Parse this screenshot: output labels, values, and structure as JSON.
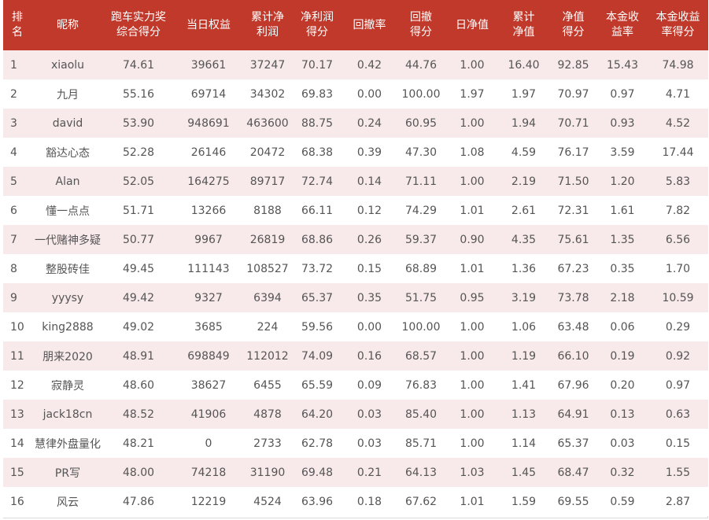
{
  "table": {
    "headers": [
      [
        "排",
        "名"
      ],
      [
        "昵称"
      ],
      [
        "跑车实力奖",
        "综合得分"
      ],
      [
        "当日权益"
      ],
      [
        "累计净",
        "利润"
      ],
      [
        "净利润",
        "得分"
      ],
      [
        "回撤率"
      ],
      [
        "回撤",
        "得分"
      ],
      [
        "日净值"
      ],
      [
        "累计",
        "净值"
      ],
      [
        "净值",
        "得分"
      ],
      [
        "本金收",
        "益率"
      ],
      [
        "本金收益",
        "率得分"
      ]
    ],
    "rows": [
      [
        "1",
        "xiaolu",
        "74.61",
        "39661",
        "37247",
        "70.17",
        "0.42",
        "44.76",
        "1.00",
        "16.40",
        "92.85",
        "15.43",
        "74.98"
      ],
      [
        "2",
        "九月",
        "55.16",
        "69714",
        "34302",
        "69.83",
        "0.00",
        "100.00",
        "1.97",
        "1.97",
        "70.97",
        "0.97",
        "4.71"
      ],
      [
        "3",
        "david",
        "53.90",
        "948691",
        "463600",
        "88.75",
        "0.24",
        "60.95",
        "1.00",
        "1.94",
        "70.71",
        "0.93",
        "4.52"
      ],
      [
        "4",
        "豁达心态",
        "52.28",
        "26146",
        "20472",
        "68.38",
        "0.39",
        "47.30",
        "1.08",
        "4.59",
        "76.17",
        "3.59",
        "17.44"
      ],
      [
        "5",
        "Alan",
        "52.05",
        "164275",
        "89717",
        "72.74",
        "0.14",
        "71.11",
        "1.00",
        "2.19",
        "71.50",
        "1.20",
        "5.83"
      ],
      [
        "6",
        "懂一点点",
        "51.71",
        "13266",
        "8188",
        "66.11",
        "0.12",
        "74.29",
        "1.01",
        "2.61",
        "72.31",
        "1.61",
        "7.82"
      ],
      [
        "7",
        "一代赌神多疑",
        "50.77",
        "9967",
        "26819",
        "68.86",
        "0.26",
        "59.37",
        "0.90",
        "4.35",
        "75.61",
        "1.35",
        "6.56"
      ],
      [
        "8",
        "整股砖佳",
        "49.45",
        "111143",
        "108527",
        "73.72",
        "0.15",
        "68.89",
        "1.01",
        "1.36",
        "67.23",
        "0.35",
        "1.70"
      ],
      [
        "9",
        "yyysy",
        "49.42",
        "9327",
        "6394",
        "65.37",
        "0.35",
        "51.75",
        "0.95",
        "3.19",
        "73.78",
        "2.18",
        "10.59"
      ],
      [
        "10",
        "king2888",
        "49.02",
        "3685",
        "224",
        "59.56",
        "0.00",
        "100.00",
        "1.00",
        "1.06",
        "63.48",
        "0.06",
        "0.29"
      ],
      [
        "11",
        "朋来2020",
        "48.91",
        "698849",
        "112012",
        "74.09",
        "0.16",
        "68.57",
        "1.00",
        "1.19",
        "66.10",
        "0.19",
        "0.92"
      ],
      [
        "12",
        "寂静灵",
        "48.60",
        "38627",
        "6455",
        "65.59",
        "0.09",
        "76.83",
        "1.00",
        "1.41",
        "67.96",
        "0.20",
        "0.97"
      ],
      [
        "13",
        "jack18cn",
        "48.52",
        "41906",
        "4878",
        "64.20",
        "0.03",
        "85.40",
        "1.00",
        "1.13",
        "64.91",
        "0.13",
        "0.63"
      ],
      [
        "14",
        "慧律外盘量化",
        "48.21",
        "0",
        "2733",
        "62.78",
        "0.03",
        "85.71",
        "1.00",
        "1.14",
        "65.37",
        "0.03",
        "0.15"
      ],
      [
        "15",
        "PR写",
        "48.00",
        "74218",
        "31190",
        "69.48",
        "0.21",
        "64.13",
        "1.03",
        "1.45",
        "68.47",
        "0.32",
        "1.55"
      ],
      [
        "16",
        "风云",
        "47.86",
        "12219",
        "4524",
        "63.96",
        "0.18",
        "67.62",
        "1.01",
        "1.59",
        "69.55",
        "0.59",
        "2.87"
      ]
    ]
  },
  "colors": {
    "header_bg": "#c0392b",
    "header_text": "#ffffff",
    "stripe_bg": "#f8e9ea",
    "cell_text": "#555555"
  }
}
